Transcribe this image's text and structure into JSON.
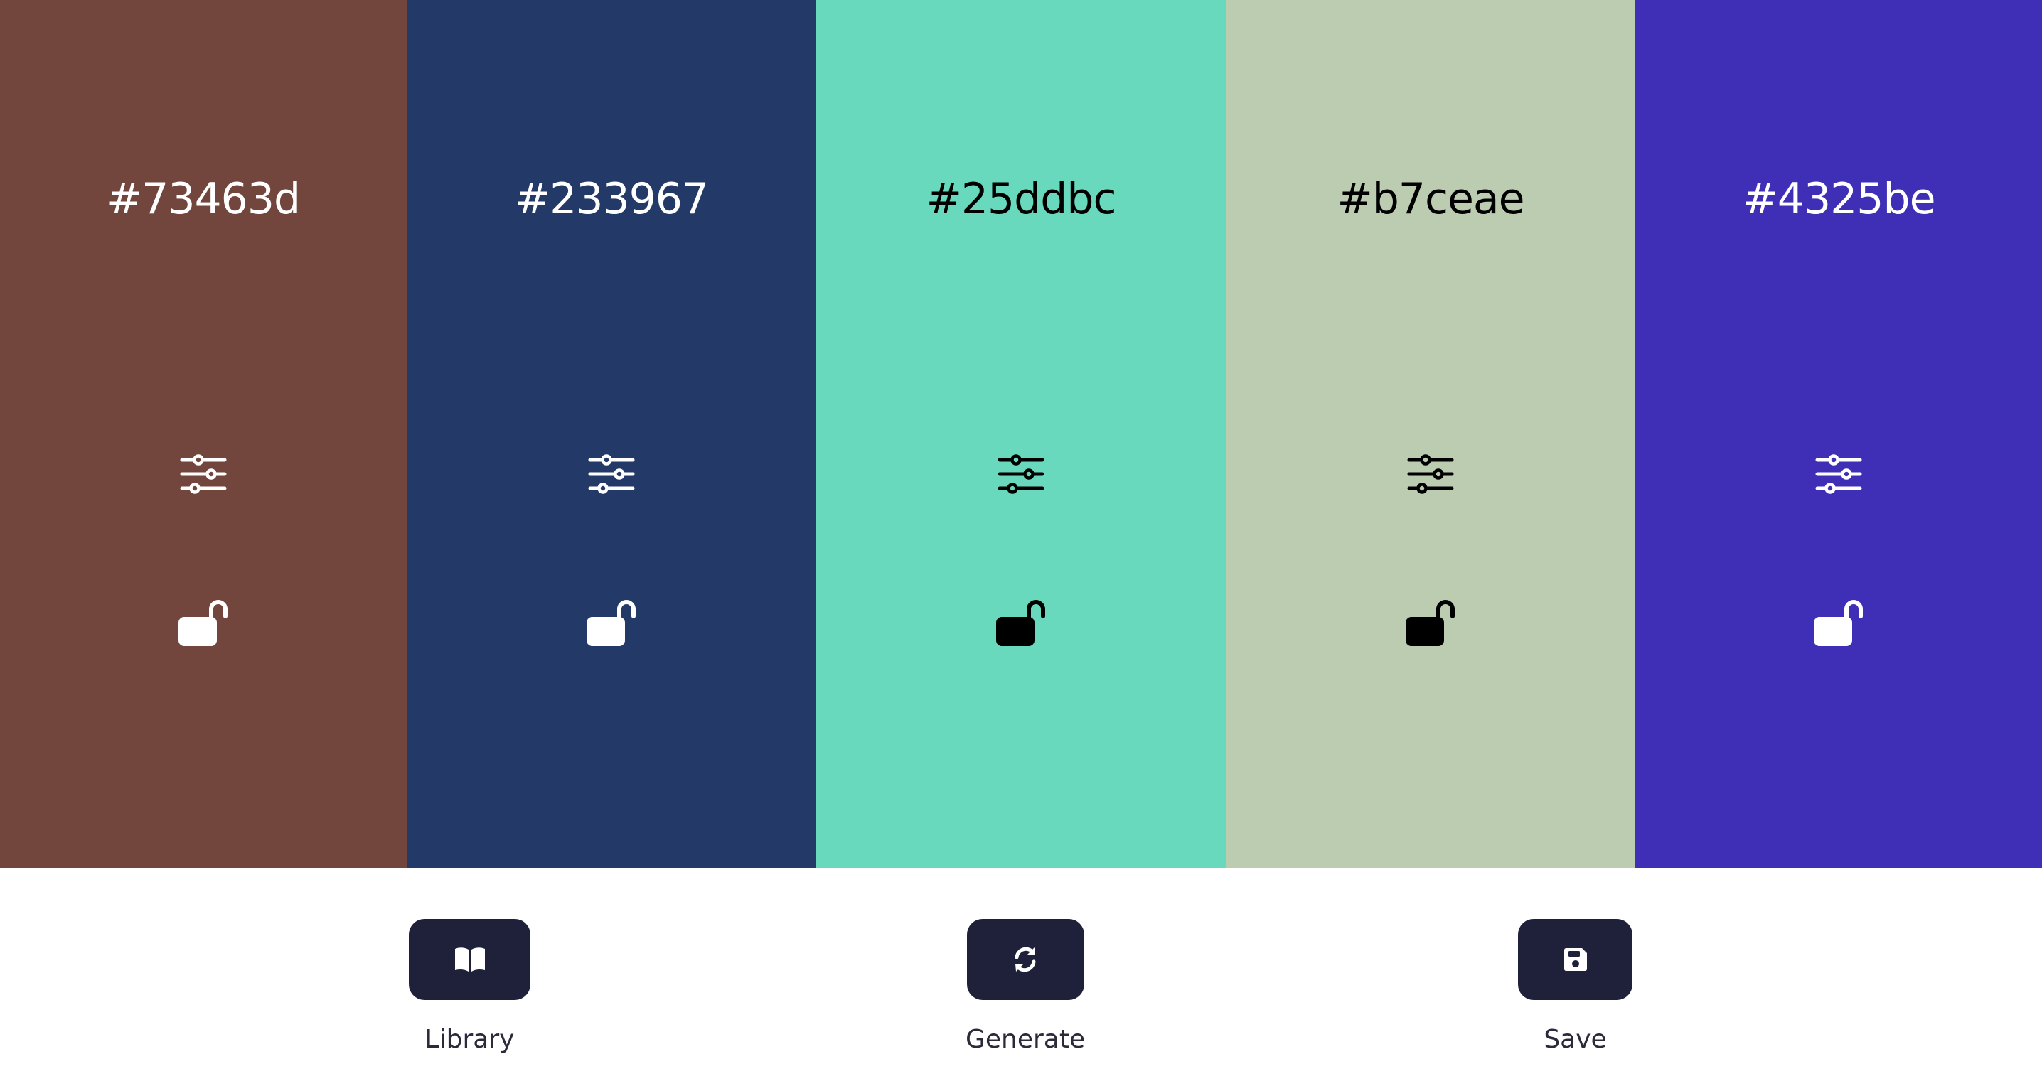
{
  "palette": {
    "swatches": [
      {
        "hex": "#73463d",
        "color": "#73463d",
        "text_color": "#ffffff",
        "locked": false,
        "adjust_icon": "sliders-icon",
        "lock_icon": "unlock-icon"
      },
      {
        "hex": "#233967",
        "color": "#233967",
        "text_color": "#ffffff",
        "locked": false,
        "adjust_icon": "sliders-icon",
        "lock_icon": "unlock-icon"
      },
      {
        "hex": "#25ddbc",
        "color": "#69d9be",
        "text_color": "#000000",
        "locked": false,
        "adjust_icon": "sliders-icon",
        "lock_icon": "unlock-icon"
      },
      {
        "hex": "#b7ceae",
        "color": "#bbccb1",
        "text_color": "#000000",
        "locked": false,
        "adjust_icon": "sliders-icon",
        "lock_icon": "unlock-icon"
      },
      {
        "hex": "#4325be",
        "color": "#3f2fb7",
        "text_color": "#ffffff",
        "locked": false,
        "adjust_icon": "sliders-icon",
        "lock_icon": "unlock-icon"
      }
    ]
  },
  "toolbar": {
    "background": "#ffffff",
    "button_color": "#1e2139",
    "library": {
      "label": "Library",
      "icon": "book-open-icon"
    },
    "generate": {
      "label": "Generate",
      "icon": "refresh-icon"
    },
    "save": {
      "label": "Save",
      "icon": "floppy-disk-icon"
    }
  }
}
